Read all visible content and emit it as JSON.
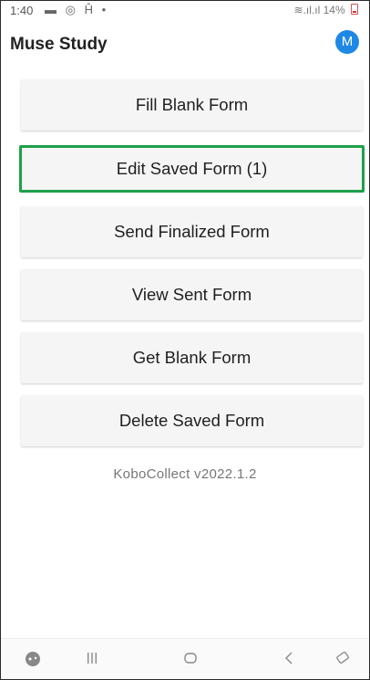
{
  "status_bar": {
    "time": "1:40",
    "left_icons": "▬ © H •",
    "right_text": "≋.∥.∥ 14%"
  },
  "app": {
    "title": "Muse Study",
    "avatar_letter": "M"
  },
  "menu": {
    "fill_blank": "Fill Blank Form",
    "edit_saved": "Edit Saved Form (1)",
    "send_finalized": "Send Finalized Form",
    "view_sent": "View Sent Form",
    "get_blank": "Get Blank Form",
    "delete_saved": "Delete Saved Form"
  },
  "version": "KoboCollect v2022.1.2",
  "colors": {
    "highlight_border": "#1ea04a",
    "avatar_bg": "#1e88e5"
  },
  "nav_icons": [
    "game-controller-icon",
    "recent-apps-icon",
    "home-icon",
    "back-icon",
    "rotate-icon"
  ]
}
